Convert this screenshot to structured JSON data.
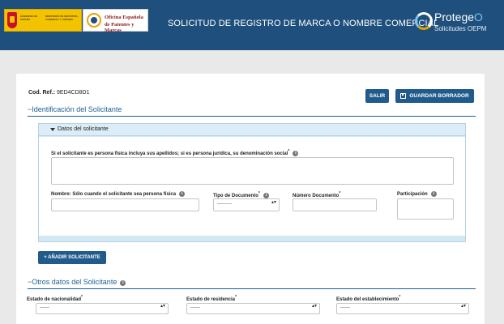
{
  "header": {
    "gov_logo": {
      "text_left": "GOBIERNO DE ESPAÑA",
      "text_right": "MINISTERIO DE INDUSTRIA, COMERCIO Y TURISMO"
    },
    "oepm_logo": {
      "line1": "Oficina Española",
      "line2": "de Patentes y Marcas"
    },
    "title": "SOLICITUD DE REGISTRO DE MARCA O NOMBRE COMERCIAL",
    "protegeo": {
      "name_main": "Protege",
      "name_o": "O",
      "subtitle": "Solicitudes OEPM"
    },
    "colors": {
      "bar": "#1f4f7c",
      "accent": "#7cc4f0"
    }
  },
  "form": {
    "ref_label": "Cod. Ref.:",
    "ref_value": "9ED4CD8D1",
    "salir_label": "SALIR",
    "guardar_label": "GUARDAR BORRADOR",
    "guardar_icon": "save-icon",
    "section1_title": "Identificación del Solicitante",
    "section1_toggle": "−",
    "panel": {
      "title": "Datos del solicitante",
      "denominacion_label": "Si el solicitante es persona física incluya sus apellidos; si es persona jurídica, su denominación social",
      "nombre_label": "Nombre: Sólo cuando el solicitante sea persona física",
      "tipo_doc_label": "Tipo de Documento",
      "tipo_doc_value": "---------",
      "numero_doc_label": "Número Documento",
      "participacion_label": "Participación"
    },
    "add_solicitante_label": "+ AÑADIR SOLICITANTE",
    "section2_title": "Otros datos del Solicitante",
    "section2_toggle": "−",
    "nacionalidad_label": "Estado de nacionalidad",
    "nacionalidad_value": "------",
    "residencia_label": "Estado de residencia",
    "residencia_value": "------",
    "establecimiento_label": "Estado del establecimiento",
    "establecimiento_value": "------",
    "required_mark": "*",
    "info_glyph": "i",
    "select_arrows": "▴▾"
  }
}
